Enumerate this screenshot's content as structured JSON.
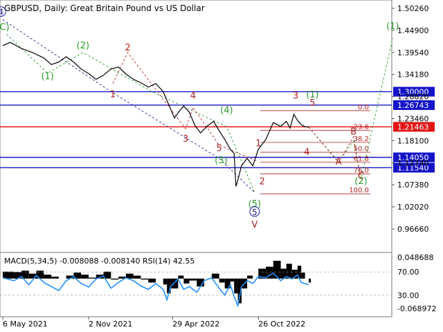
{
  "chart_data": {
    "type": "line",
    "title": "GBPUSD, Daily:  Great Britain Pound vs US Dollar",
    "price_axis": {
      "ticks": [
        "1.50260",
        "1.44900",
        "1.39540",
        "1.34180",
        "1.28820",
        "1.23460",
        "1.18100",
        "1.12740",
        "1.07380",
        "1.02020",
        "0.96660"
      ]
    },
    "time_axis": {
      "ticks": [
        "6 May 2021",
        "2 Nov 2021",
        "29 Apr 2022",
        "26 Oct 2022"
      ]
    },
    "price_series": {
      "name": "GBPUSD",
      "points": [
        [
          0,
          1.412
        ],
        [
          4,
          1.42
        ],
        [
          10,
          1.405
        ],
        [
          16,
          1.395
        ],
        [
          22,
          1.382
        ],
        [
          26,
          1.366
        ],
        [
          30,
          1.372
        ],
        [
          34,
          1.385
        ],
        [
          38,
          1.372
        ],
        [
          42,
          1.355
        ],
        [
          46,
          1.344
        ],
        [
          50,
          1.33
        ],
        [
          54,
          1.34
        ],
        [
          58,
          1.355
        ],
        [
          62,
          1.36
        ],
        [
          66,
          1.343
        ],
        [
          70,
          1.33
        ],
        [
          74,
          1.322
        ],
        [
          78,
          1.311
        ],
        [
          82,
          1.32
        ],
        [
          84,
          1.31
        ],
        [
          86,
          1.3
        ],
        [
          89,
          1.268
        ],
        [
          92,
          1.236
        ],
        [
          95,
          1.255
        ],
        [
          97,
          1.265
        ],
        [
          100,
          1.25
        ],
        [
          103,
          1.218
        ],
        [
          106,
          1.2
        ],
        [
          110,
          1.218
        ],
        [
          113,
          1.228
        ],
        [
          116,
          1.205
        ],
        [
          119,
          1.184
        ],
        [
          122,
          1.16
        ],
        [
          124,
          1.15
        ],
        [
          125,
          1.07
        ],
        [
          126,
          1.085
        ],
        [
          128,
          1.121
        ],
        [
          131,
          1.138
        ],
        [
          134,
          1.12
        ],
        [
          137,
          1.16
        ],
        [
          141,
          1.184
        ],
        [
          145,
          1.225
        ],
        [
          149,
          1.216
        ],
        [
          152,
          1.228
        ],
        [
          154,
          1.212
        ],
        [
          156,
          1.245
        ],
        [
          158,
          1.23
        ],
        [
          160,
          1.22
        ],
        [
          162,
          1.215
        ],
        [
          164,
          1.214
        ]
      ]
    },
    "horizontal_levels": [
      {
        "value": 1.3,
        "label": "1.30000",
        "color": "#1414c8"
      },
      {
        "value": 1.26743,
        "label": "1.26743",
        "color": "#1414c8"
      },
      {
        "value": 1.21463,
        "label": "1.21463",
        "color": "#e11414"
      },
      {
        "value": 1.1405,
        "label": "1.14050",
        "color": "#1414c8"
      },
      {
        "value": 1.1154,
        "label": "1.11540",
        "color": "#1414c8"
      }
    ],
    "fibonacci_levels": [
      "0.0",
      "23.6",
      "38.2",
      "50.0",
      "61.8",
      "76.0",
      "100.0"
    ],
    "wave_labels": [
      {
        "text": "4",
        "style": "circle-blue",
        "date": -1,
        "price": 1.488
      },
      {
        "text": "C",
        "style": "paren-green",
        "date": 0,
        "price": 1.45
      },
      {
        "text": "1",
        "style": "paren-green",
        "date": 24,
        "price": 1.33
      },
      {
        "text": "2",
        "style": "paren-green",
        "date": 43,
        "price": 1.405
      },
      {
        "text": "2",
        "style": "plain-red",
        "date": 67,
        "price": 1.4
      },
      {
        "text": "1",
        "style": "plain-red",
        "date": 59,
        "price": 1.287
      },
      {
        "text": "4",
        "style": "plain-red",
        "date": 102,
        "price": 1.283
      },
      {
        "text": "3",
        "style": "plain-red",
        "date": 98,
        "price": 1.178
      },
      {
        "text": "4",
        "style": "paren-green",
        "date": 120,
        "price": 1.248
      },
      {
        "text": "5",
        "style": "plain-red",
        "date": 116,
        "price": 1.156
      },
      {
        "text": "3",
        "style": "paren-green",
        "date": 117,
        "price": 1.126
      },
      {
        "text": "1",
        "style": "plain-red",
        "date": 137,
        "price": 1.167
      },
      {
        "text": "2",
        "style": "plain-red",
        "date": 139,
        "price": 1.075
      },
      {
        "text": "5",
        "style": "paren-green",
        "date": 135,
        "price": 1.02
      },
      {
        "text": "5",
        "style": "circle-blue",
        "date": 135,
        "price": 1.002
      },
      {
        "text": "V",
        "style": "plain-red",
        "date": 135,
        "price": 0.97
      },
      {
        "text": "3",
        "style": "plain-red",
        "date": 157,
        "price": 1.283
      },
      {
        "text": "1",
        "style": "paren-green",
        "date": 166,
        "price": 1.286
      },
      {
        "text": "5",
        "style": "plain-red",
        "date": 166,
        "price": 1.266
      },
      {
        "text": "4",
        "style": "plain-red",
        "date": 163,
        "price": 1.146
      },
      {
        "text": "B",
        "style": "plain-red",
        "date": 188,
        "price": 1.196
      },
      {
        "text": "A",
        "style": "plain-red",
        "date": 180,
        "price": 1.123
      },
      {
        "text": "C",
        "style": "plain-red",
        "date": 192,
        "price": 1.088
      },
      {
        "text": "2",
        "style": "paren-green",
        "date": 192,
        "price": 1.076
      },
      {
        "text": "1",
        "style": "paren-green",
        "date": 209,
        "price": 1.452
      }
    ],
    "indicator": {
      "title": "MACD(5,34,5) -0.008088 -0.008140 RSI(14) 42.55",
      "ticks": [
        "0.048688",
        "70.00",
        "30.00",
        "-0.068972"
      ],
      "rsi_points": [
        [
          0,
          60
        ],
        [
          6,
          55
        ],
        [
          10,
          62
        ],
        [
          14,
          48
        ],
        [
          18,
          64
        ],
        [
          22,
          52
        ],
        [
          26,
          45
        ],
        [
          30,
          38
        ],
        [
          34,
          55
        ],
        [
          38,
          62
        ],
        [
          42,
          50
        ],
        [
          46,
          44
        ],
        [
          50,
          58
        ],
        [
          54,
          63
        ],
        [
          58,
          42
        ],
        [
          62,
          52
        ],
        [
          66,
          60
        ],
        [
          70,
          55
        ],
        [
          74,
          46
        ],
        [
          78,
          40
        ],
        [
          82,
          50
        ],
        [
          86,
          40
        ],
        [
          88,
          22
        ],
        [
          90,
          45
        ],
        [
          94,
          58
        ],
        [
          97,
          40
        ],
        [
          100,
          45
        ],
        [
          104,
          35
        ],
        [
          108,
          55
        ],
        [
          112,
          60
        ],
        [
          116,
          42
        ],
        [
          119,
          30
        ],
        [
          122,
          48
        ],
        [
          124,
          28
        ],
        [
          126,
          12
        ],
        [
          128,
          45
        ],
        [
          131,
          55
        ],
        [
          134,
          50
        ],
        [
          137,
          62
        ],
        [
          141,
          60
        ],
        [
          145,
          68
        ],
        [
          149,
          55
        ],
        [
          152,
          62
        ],
        [
          155,
          58
        ],
        [
          158,
          65
        ],
        [
          160,
          52
        ],
        [
          162,
          50
        ],
        [
          164,
          48
        ]
      ],
      "macd_points": [
        [
          0,
          0.014
        ],
        [
          6,
          0.013
        ],
        [
          10,
          0.016
        ],
        [
          14,
          0.01
        ],
        [
          18,
          0.016
        ],
        [
          22,
          0.008
        ],
        [
          26,
          0.004
        ],
        [
          30,
          0.0
        ],
        [
          34,
          0.006
        ],
        [
          38,
          0.012
        ],
        [
          42,
          0.008
        ],
        [
          46,
          0.002
        ],
        [
          50,
          0.008
        ],
        [
          54,
          0.014
        ],
        [
          58,
          -0.002
        ],
        [
          62,
          0.004
        ],
        [
          66,
          0.01
        ],
        [
          70,
          0.006
        ],
        [
          74,
          -0.002
        ],
        [
          78,
          -0.008
        ],
        [
          82,
          0.0
        ],
        [
          86,
          -0.012
        ],
        [
          88,
          -0.03
        ],
        [
          90,
          -0.02
        ],
        [
          94,
          0.006
        ],
        [
          97,
          -0.01
        ],
        [
          100,
          -0.004
        ],
        [
          104,
          -0.016
        ],
        [
          108,
          0.0
        ],
        [
          112,
          0.01
        ],
        [
          116,
          -0.008
        ],
        [
          119,
          -0.02
        ],
        [
          122,
          -0.006
        ],
        [
          124,
          -0.03
        ],
        [
          126,
          -0.05
        ],
        [
          128,
          -0.02
        ],
        [
          131,
          0.006
        ],
        [
          134,
          0.0
        ],
        [
          137,
          0.02
        ],
        [
          141,
          0.024
        ],
        [
          145,
          0.036
        ],
        [
          149,
          0.02
        ],
        [
          152,
          0.03
        ],
        [
          155,
          0.018
        ],
        [
          158,
          0.026
        ],
        [
          160,
          0.012
        ],
        [
          162,
          0.0
        ],
        [
          164,
          -0.008
        ]
      ]
    },
    "colors": {
      "price": "#000000",
      "wave_green": "#2a9a2a",
      "wave_red": "#b22222",
      "wave_blue": "#1e1e96",
      "fib": "#b22222",
      "rsi": "#1e90ff",
      "macd": "#000000"
    }
  }
}
